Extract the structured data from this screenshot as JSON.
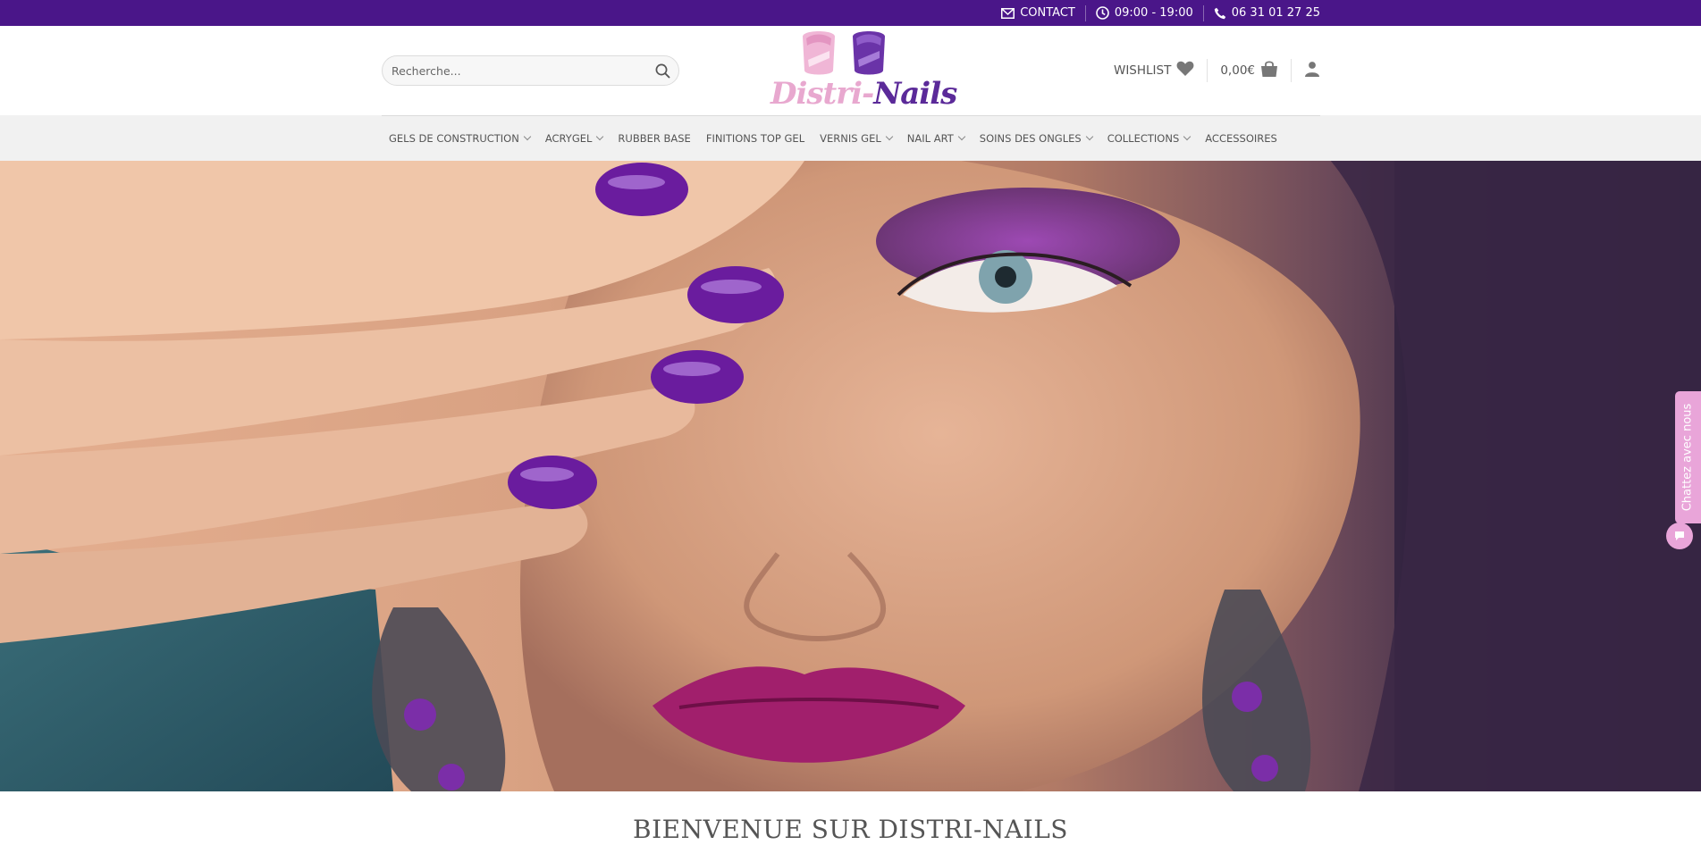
{
  "topbar": {
    "contact_label": "CONTACT",
    "hours": "09:00 - 19:00",
    "phone": "06 31 01 27 25",
    "icons": [
      "envelope-icon",
      "clock-icon",
      "phone-icon"
    ]
  },
  "header": {
    "search": {
      "placeholder": "Recherche...",
      "value": ""
    },
    "logo": {
      "text_part1": "Distri-",
      "text_part2": "Nails"
    },
    "wishlist_label": "WISHLIST",
    "cart_total": "0,00€",
    "icons": [
      "search-icon",
      "heart-icon",
      "shopping-bag-icon",
      "user-icon"
    ]
  },
  "nav": {
    "items": [
      {
        "label": "GELS DE CONSTRUCTION",
        "dropdown": true
      },
      {
        "label": "ACRYGEL",
        "dropdown": true
      },
      {
        "label": "RUBBER BASE",
        "dropdown": false
      },
      {
        "label": "FINITIONS TOP GEL",
        "dropdown": false
      },
      {
        "label": "VERNIS GEL",
        "dropdown": true
      },
      {
        "label": "NAIL ART",
        "dropdown": true
      },
      {
        "label": "SOINS DES ONGLES",
        "dropdown": true
      },
      {
        "label": "COLLECTIONS",
        "dropdown": true
      },
      {
        "label": "ACCESSOIRES",
        "dropdown": false
      }
    ]
  },
  "chat": {
    "label": "Chattez avec nous"
  },
  "welcome": {
    "title": "BIENVENUE SUR DISTRI-NAILS"
  },
  "colors": {
    "brand_purple": "#4a1689",
    "logo_pink": "#e8a8cf",
    "logo_purple": "#5b2a99",
    "chat_pink": "#e9a5d9",
    "nav_bg": "#f1f1f1"
  }
}
